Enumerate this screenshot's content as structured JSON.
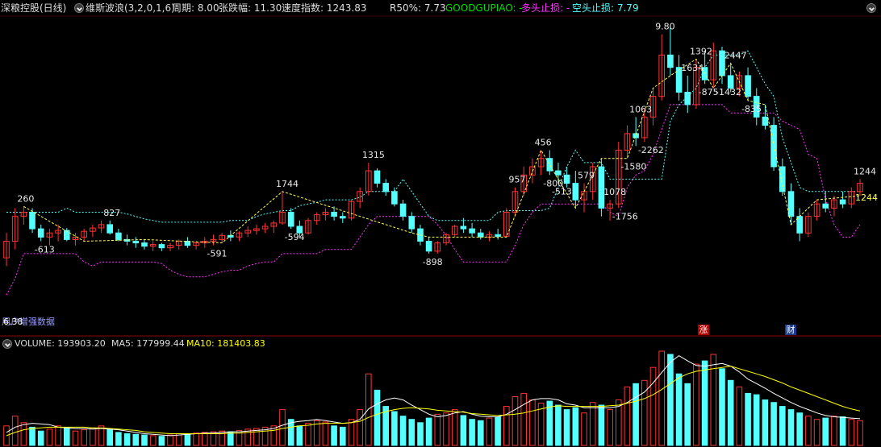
{
  "header": {
    "stock_name": "深粮控股(日线)",
    "indicator_name": "维斯波浪(3,2,0,1,6)",
    "period": "周期: 8.00",
    "change_range": "张跌幅: 11.30",
    "speed_index": "速度指数: 1243.83",
    "r50": "R50%: 7.73",
    "goodgupiao": "GOODGUPIAO: -",
    "long_stop": "多头止损: -",
    "short_stop": "空头止损: 7.79"
  },
  "volume_header": {
    "volume": "VOLUME: 193903.20",
    "ma5": "MA5: 177999.44",
    "ma10": "MA10: 181403.83"
  },
  "overlay": {
    "tip_text": "用户增强数据",
    "low_price_label": "6.38",
    "high_price_label": "9.80",
    "last_value_label": "1244"
  },
  "badges": {
    "zhang": "涨",
    "cai": "财"
  },
  "colors": {
    "up": "#ff3232",
    "down": "#54ffff",
    "wave": "#ffff52",
    "long_stop": "#ff32ff",
    "short_stop": "#54ffff",
    "ma5": "#ffffff",
    "ma10": "#ffff00",
    "green_text": "#00e000",
    "magenta_text": "#ff32ff",
    "cyan_text": "#54ffff"
  },
  "chart_data": {
    "type": "candlestick",
    "price_range": [
      6.3,
      9.9
    ],
    "candles": [
      [
        7.0,
        7.3,
        6.9,
        7.2
      ],
      [
        7.2,
        7.6,
        7.1,
        7.5
      ],
      [
        7.5,
        7.62,
        7.4,
        7.55
      ],
      [
        7.55,
        7.6,
        7.3,
        7.35
      ],
      [
        7.35,
        7.4,
        7.2,
        7.25
      ],
      [
        7.25,
        7.35,
        7.15,
        7.3
      ],
      [
        7.3,
        7.4,
        7.2,
        7.33
      ],
      [
        7.33,
        7.36,
        7.2,
        7.22
      ],
      [
        7.22,
        7.3,
        7.15,
        7.25
      ],
      [
        7.25,
        7.35,
        7.2,
        7.32
      ],
      [
        7.32,
        7.4,
        7.25,
        7.36
      ],
      [
        7.36,
        7.45,
        7.3,
        7.4
      ],
      [
        7.4,
        7.45,
        7.28,
        7.3
      ],
      [
        7.3,
        7.35,
        7.2,
        7.22
      ],
      [
        7.22,
        7.28,
        7.15,
        7.2
      ],
      [
        7.2,
        7.25,
        7.12,
        7.18
      ],
      [
        7.18,
        7.22,
        7.1,
        7.14
      ],
      [
        7.14,
        7.2,
        7.08,
        7.16
      ],
      [
        7.16,
        7.18,
        7.08,
        7.12
      ],
      [
        7.12,
        7.18,
        7.08,
        7.15
      ],
      [
        7.15,
        7.22,
        7.1,
        7.2
      ],
      [
        7.2,
        7.25,
        7.12,
        7.15
      ],
      [
        7.15,
        7.2,
        7.1,
        7.18
      ],
      [
        7.18,
        7.25,
        7.12,
        7.2
      ],
      [
        7.2,
        7.28,
        7.15,
        7.22
      ],
      [
        7.22,
        7.3,
        7.18,
        7.27
      ],
      [
        7.27,
        7.33,
        7.2,
        7.25
      ],
      [
        7.25,
        7.32,
        7.2,
        7.3
      ],
      [
        7.3,
        7.38,
        7.25,
        7.33
      ],
      [
        7.33,
        7.4,
        7.28,
        7.35
      ],
      [
        7.35,
        7.42,
        7.3,
        7.38
      ],
      [
        7.38,
        7.45,
        7.3,
        7.42
      ],
      [
        7.42,
        7.8,
        7.4,
        7.55
      ],
      [
        7.55,
        7.6,
        7.35,
        7.38
      ],
      [
        7.38,
        7.45,
        7.25,
        7.3
      ],
      [
        7.3,
        7.48,
        7.28,
        7.45
      ],
      [
        7.45,
        7.55,
        7.4,
        7.52
      ],
      [
        7.52,
        7.6,
        7.45,
        7.55
      ],
      [
        7.55,
        7.62,
        7.45,
        7.5
      ],
      [
        7.5,
        7.55,
        7.42,
        7.48
      ],
      [
        7.48,
        7.7,
        7.45,
        7.68
      ],
      [
        7.68,
        7.85,
        7.6,
        7.8
      ],
      [
        7.8,
        8.15,
        7.75,
        8.05
      ],
      [
        8.05,
        8.08,
        7.85,
        7.9
      ],
      [
        7.9,
        7.95,
        7.75,
        7.8
      ],
      [
        7.8,
        7.85,
        7.62,
        7.65
      ],
      [
        7.65,
        7.7,
        7.45,
        7.5
      ],
      [
        7.5,
        7.55,
        7.3,
        7.35
      ],
      [
        7.35,
        7.4,
        7.15,
        7.2
      ],
      [
        7.2,
        7.25,
        7.05,
        7.08
      ],
      [
        7.08,
        7.2,
        7.05,
        7.18
      ],
      [
        7.18,
        7.3,
        7.15,
        7.28
      ],
      [
        7.28,
        7.4,
        7.25,
        7.38
      ],
      [
        7.38,
        7.48,
        7.3,
        7.35
      ],
      [
        7.35,
        7.42,
        7.25,
        7.3
      ],
      [
        7.3,
        7.35,
        7.22,
        7.25
      ],
      [
        7.25,
        7.32,
        7.2,
        7.28
      ],
      [
        7.28,
        7.35,
        7.22,
        7.26
      ],
      [
        7.26,
        7.6,
        7.25,
        7.55
      ],
      [
        7.55,
        7.85,
        7.5,
        7.8
      ],
      [
        7.8,
        8.1,
        7.75,
        8.0
      ],
      [
        8.0,
        8.2,
        7.9,
        8.1
      ],
      [
        8.1,
        8.3,
        8.0,
        8.2
      ],
      [
        8.2,
        8.3,
        8.0,
        8.05
      ],
      [
        8.05,
        8.15,
        7.9,
        8.0
      ],
      [
        8.0,
        8.1,
        7.85,
        7.9
      ],
      [
        7.9,
        8.05,
        7.6,
        7.7
      ],
      [
        7.7,
        7.9,
        7.55,
        7.8
      ],
      [
        7.8,
        8.15,
        7.7,
        8.1
      ],
      [
        8.1,
        8.2,
        7.5,
        7.6
      ],
      [
        7.6,
        7.7,
        7.45,
        7.65
      ],
      [
        7.65,
        8.4,
        7.6,
        8.3
      ],
      [
        8.3,
        8.6,
        8.2,
        8.5
      ],
      [
        8.5,
        8.7,
        8.35,
        8.45
      ],
      [
        8.45,
        8.8,
        8.4,
        8.7
      ],
      [
        8.7,
        9.05,
        8.6,
        8.95
      ],
      [
        8.95,
        9.7,
        8.9,
        9.45
      ],
      [
        9.45,
        9.8,
        9.2,
        9.3
      ],
      [
        9.3,
        9.45,
        8.9,
        9.0
      ],
      [
        9.0,
        9.2,
        8.75,
        8.85
      ],
      [
        8.85,
        9.4,
        8.8,
        9.3
      ],
      [
        9.3,
        9.5,
        9.1,
        9.15
      ],
      [
        9.15,
        9.6,
        9.05,
        9.5
      ],
      [
        9.5,
        9.55,
        9.1,
        9.2
      ],
      [
        9.2,
        9.35,
        9.0,
        9.05
      ],
      [
        9.05,
        9.25,
        8.95,
        9.2
      ],
      [
        9.2,
        9.3,
        8.9,
        8.95
      ],
      [
        8.95,
        9.05,
        8.6,
        8.7
      ],
      [
        8.7,
        8.85,
        8.55,
        8.6
      ],
      [
        8.6,
        8.7,
        8.05,
        8.1
      ],
      [
        8.1,
        8.2,
        7.75,
        7.8
      ],
      [
        7.8,
        7.9,
        7.4,
        7.5
      ],
      [
        7.5,
        7.6,
        7.2,
        7.3
      ],
      [
        7.3,
        7.55,
        7.25,
        7.5
      ],
      [
        7.5,
        7.7,
        7.45,
        7.65
      ],
      [
        7.65,
        7.8,
        7.55,
        7.6
      ],
      [
        7.6,
        7.75,
        7.5,
        7.7
      ],
      [
        7.7,
        7.8,
        7.6,
        7.65
      ],
      [
        7.65,
        7.85,
        7.6,
        7.8
      ],
      [
        7.8,
        7.95,
        7.75,
        7.9
      ]
    ],
    "volumes": [
      30,
      45,
      35,
      28,
      22,
      25,
      30,
      26,
      22,
      24,
      27,
      30,
      25,
      20,
      18,
      17,
      16,
      15,
      14,
      16,
      18,
      17,
      19,
      20,
      21,
      22,
      21,
      23,
      25,
      26,
      28,
      30,
      55,
      40,
      30,
      34,
      38,
      36,
      30,
      28,
      40,
      55,
      110,
      85,
      60,
      52,
      45,
      40,
      35,
      42,
      48,
      50,
      55,
      46,
      40,
      38,
      42,
      44,
      60,
      75,
      80,
      70,
      65,
      68,
      62,
      55,
      58,
      50,
      66,
      62,
      55,
      70,
      90,
      95,
      100,
      120,
      145,
      140,
      110,
      95,
      125,
      130,
      140,
      118,
      100,
      90,
      80,
      78,
      70,
      66,
      60,
      55,
      50,
      45,
      40,
      42,
      45,
      44,
      40,
      38
    ],
    "ma5": [
      20,
      28,
      32,
      34,
      33,
      32,
      28,
      27,
      26,
      26,
      25,
      26,
      25,
      24,
      22,
      20,
      18,
      17,
      16,
      15,
      16,
      17,
      18,
      19,
      19,
      20,
      21,
      21,
      22,
      23,
      24,
      26,
      31,
      35,
      37,
      38,
      40,
      38,
      36,
      34,
      35,
      40,
      56,
      64,
      70,
      73,
      70,
      62,
      55,
      48,
      44,
      46,
      50,
      52,
      48,
      45,
      44,
      44,
      48,
      55,
      63,
      70,
      72,
      72,
      70,
      64,
      62,
      58,
      58,
      58,
      58,
      60,
      66,
      74,
      82,
      96,
      112,
      128,
      138,
      130,
      123,
      122,
      124,
      126,
      122,
      113,
      102,
      95,
      88,
      80,
      73,
      66,
      60,
      55,
      50,
      46,
      44,
      43,
      42,
      41
    ],
    "ma10": [
      15,
      20,
      24,
      26,
      27,
      28,
      28,
      28,
      28,
      28,
      27,
      27,
      26,
      25,
      24,
      23,
      21,
      20,
      19,
      18,
      18,
      18,
      18,
      18,
      18,
      18,
      19,
      19,
      20,
      21,
      22,
      23,
      26,
      28,
      30,
      31,
      33,
      34,
      34,
      34,
      35,
      37,
      43,
      48,
      52,
      55,
      57,
      58,
      57,
      56,
      54,
      53,
      52,
      51,
      49,
      48,
      47,
      46,
      47,
      48,
      50,
      53,
      56,
      59,
      61,
      60,
      60,
      60,
      60,
      60,
      61,
      62,
      65,
      68,
      72,
      78,
      86,
      95,
      104,
      110,
      114,
      116,
      118,
      120,
      122,
      118,
      114,
      110,
      106,
      101,
      96,
      90,
      85,
      80,
      75,
      70,
      65,
      60,
      56,
      53
    ],
    "wave_labels": [
      "260",
      "-613",
      "827",
      "-591",
      "1744",
      "-594",
      "1315",
      "-898",
      "957",
      "456",
      "-800",
      "-513",
      "579",
      "1078",
      "-1756",
      "1063",
      "9.80",
      "1634",
      "-1580",
      "-2262",
      "1392",
      "-875",
      "-1432",
      "2447",
      "-835",
      "1244"
    ]
  }
}
